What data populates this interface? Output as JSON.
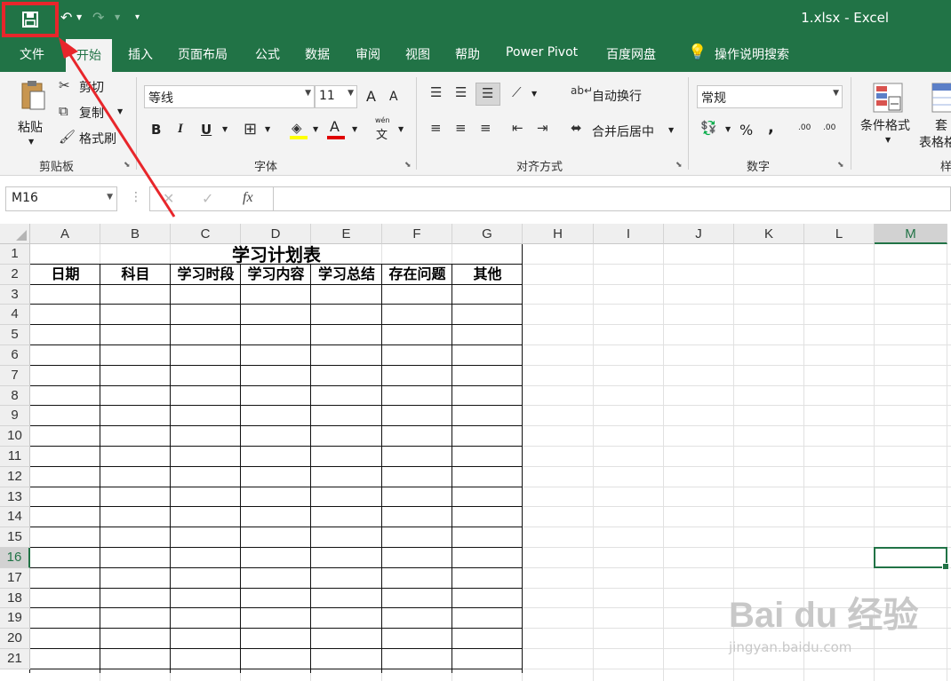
{
  "window": {
    "title": "1.xlsx  -  Excel"
  },
  "colors": {
    "excel_green": "#217346",
    "highlight_red": "#e8262b"
  },
  "tabs": [
    {
      "label": "文件"
    },
    {
      "label": "开始",
      "active": true
    },
    {
      "label": "插入"
    },
    {
      "label": "页面布局"
    },
    {
      "label": "公式"
    },
    {
      "label": "数据"
    },
    {
      "label": "审阅"
    },
    {
      "label": "视图"
    },
    {
      "label": "帮助"
    },
    {
      "label": "Power Pivot"
    },
    {
      "label": "百度网盘"
    },
    {
      "label": "操作说明搜索"
    }
  ],
  "ribbon": {
    "clipboard": {
      "paste": "粘贴",
      "cut": "剪切",
      "copy": "复制",
      "format_painter": "格式刷",
      "group": "剪贴板"
    },
    "font": {
      "name": "等线",
      "size": "11",
      "bold": "B",
      "italic": "I",
      "underline": "U",
      "color_letter": "A",
      "grow": "A",
      "shrink": "A",
      "wen_top": "wén",
      "wen_bottom": "文",
      "group": "字体"
    },
    "alignment": {
      "wrap": "自动换行",
      "merge": "合并后居中",
      "group": "对齐方式"
    },
    "number": {
      "format": "常规",
      "percent": "%",
      "comma": ",",
      "inc": ".00",
      "dec": ".00",
      "group": "数字"
    },
    "styles": {
      "conditional": "条件格式",
      "table_top": "套",
      "table_bottom": "表格格",
      "group_partial": "样"
    }
  },
  "formula_bar": {
    "name_box": "M16",
    "fx": "fx",
    "cancel": "✕",
    "enter": "✓",
    "value": ""
  },
  "columns": [
    "A",
    "B",
    "C",
    "D",
    "E",
    "F",
    "G",
    "H",
    "I",
    "J",
    "K",
    "L",
    "M"
  ],
  "selected_column": "M",
  "rows": [
    "1",
    "2",
    "3",
    "4",
    "5",
    "6",
    "7",
    "8",
    "9",
    "10",
    "11",
    "12",
    "13",
    "14",
    "15",
    "16",
    "17",
    "18",
    "19",
    "20",
    "21"
  ],
  "selected_row": "16",
  "sheet": {
    "title": "学习计划表",
    "headers": [
      "日期",
      "科目",
      "学习时段",
      "学习内容",
      "学习总结",
      "存在问题",
      "其他"
    ]
  },
  "watermark": {
    "brand": "Bai du 经验",
    "url": "jingyan.baidu.com"
  }
}
